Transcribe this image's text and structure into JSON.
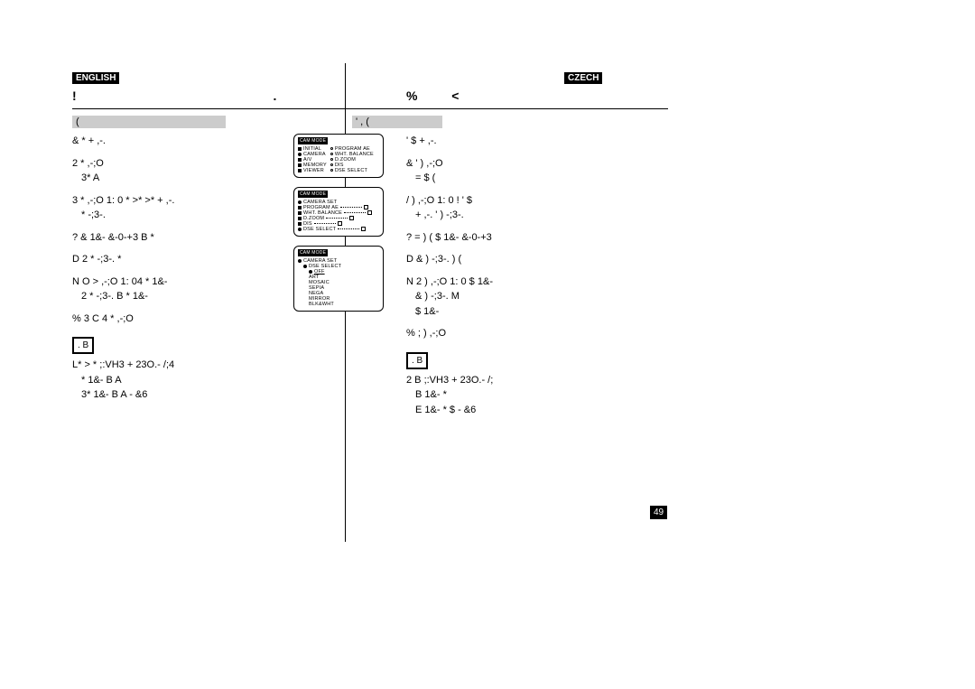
{
  "lang": {
    "left": "ENGLISH",
    "right": "CZECH"
  },
  "heading": {
    "left_a": "!",
    "left_b": ".",
    "right_a": "%",
    "right_b": "<"
  },
  "subhead": {
    "left": "(",
    "right": "'  ,  ("
  },
  "page_number": "49",
  "left_col": {
    "s1": "&    *          + ,-.",
    "s2a": "2    * ,-;O",
    "s2b": "3*        A",
    "s3a": "3    * ,-;O 1: 0    * >* >*  + ,-.",
    "s3b": "*  -;3-.",
    "s4": "?  &    1&-  &-0-+3 B    *",
    "s5": "D  2    *  -;3-.        *",
    "s6a": "N   O   > ,-;O 1: 04        * 1&-",
    "s6b": "2    *  -;3-.      B    *  1&-",
    "s7": "%   3   C 4       * ,-;O",
    "box": ". B",
    "n1": "L*        >  *  ;:VH3 + 23O.-   /;4",
    "n2": "*  1&- B         A",
    "n3": "3*  1&- B      A           - &6"
  },
  "right_col": {
    "s1": "'     $    + ,-.",
    "s2a": "&   '    ) ,-;O",
    "s2b": "=            $   (",
    "s3a": "/   ) ,-;O 1: 0  !   '     $",
    "s3b": "+ ,-.        '   )  -;3-.",
    "s4": "?  =    )   (     $  1&-  &-0-+3",
    "s5": "D  &     )  -;3-.       )   (",
    "s6a": "N  2       ) ,-;O 1: 0      $  1&-",
    "s6b": "&    )  -;3-.    M",
    "s6c": "$   1&-",
    "s7": "%   ;          )   ,-;O",
    "box": ". B",
    "n1": "2     B    ;:VH3 + 23O.-   /;",
    "n2": "B     1&-  *",
    "n3": "E    1&-       *    $    - &6"
  },
  "menus": {
    "title": "CAM MODE",
    "box1": {
      "left": [
        "INITIAL",
        "CAMERA",
        "A/V",
        "MEMORY",
        "VIEWER"
      ],
      "right": [
        "PROGRAM AE",
        "WHT. BALANCE",
        "D.ZOOM",
        "DIS",
        "DSE SELECT"
      ]
    },
    "box2": {
      "heading": "CAMERA SET",
      "items": [
        "PROGRAM AE",
        "WHT. BALANCE",
        "D.ZOOM",
        "DIS",
        "DSE SELECT"
      ]
    },
    "box3": {
      "heading": "CAMERA SET",
      "sub": "DSE SELECT",
      "items": [
        "OFF",
        "ART",
        "MOSAIC",
        "SEPIA",
        "NEGA",
        "MIRROR",
        "BLK&WHT"
      ]
    }
  }
}
